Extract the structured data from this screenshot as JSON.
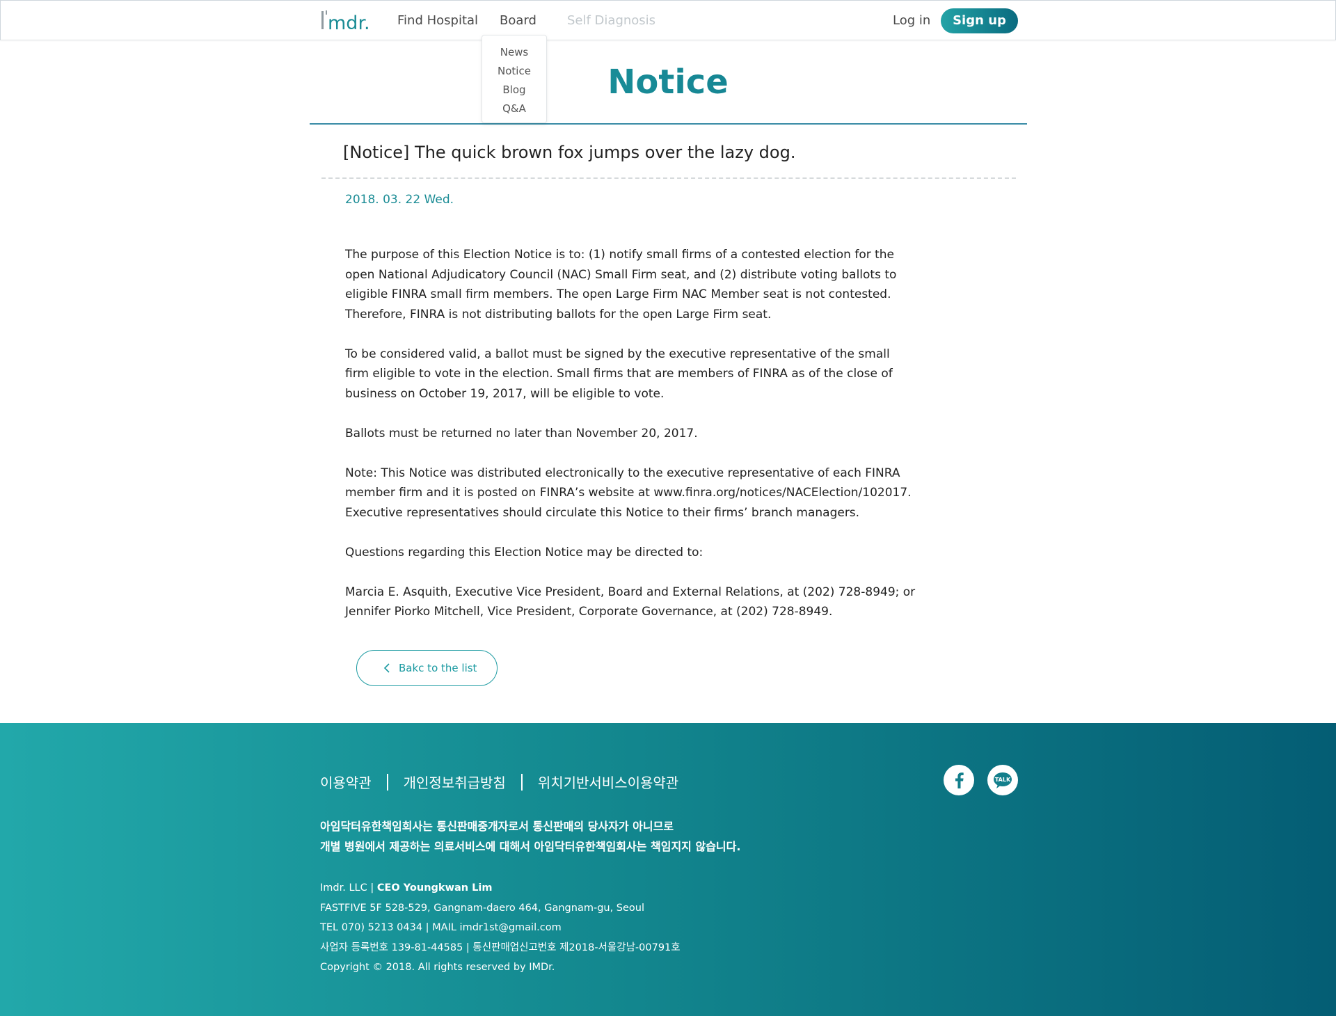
{
  "header": {
    "logo_text": "I'mdr.",
    "nav": {
      "find_hospital": "Find Hospital",
      "board": "Board",
      "self_diagnosis": "Self Diagnosis"
    },
    "login": "Log in",
    "signup": "Sign up",
    "board_menu": [
      "News",
      "Notice",
      "Blog",
      "Q&A"
    ]
  },
  "page_title": "Notice",
  "post": {
    "heading": "[Notice] The quick brown fox jumps over the lazy dog.",
    "date": "2018. 03. 22 Wed.",
    "paragraphs": [
      "The purpose of this Election Notice is to: (1) notify small firms of a contested election for the open National Adjudicatory Council (NAC) Small Firm seat, and (2) distribute voting ballots to eligible FINRA small firm members. The open Large Firm NAC Member seat is not contested. Therefore, FINRA is not distributing ballots for the open Large Firm seat.",
      "To be considered valid, a ballot must be signed by the executive representative of the small firm eligible to vote in the election. Small firms that are members of FINRA as of the close of business on October 19, 2017, will be eligible to vote.",
      "Ballots must be returned no later than November 20, 2017.",
      "Note: This Notice was distributed electronically to the executive representative of each FINRA member firm and it is posted on FINRA’s website at www.finra.org/notices/NACElection/102017. Executive representatives should circulate this Notice to their firms’ branch managers.",
      "Questions regarding this Election Notice may be directed to:",
      "Marcia E. Asquith, Executive Vice President, Board and External Relations, at (202) 728-8949; or Jennifer Piorko Mitchell, Vice President, Corporate Governance, at (202) 728-8949."
    ],
    "back_label": "Bakc to the list"
  },
  "footer": {
    "links": [
      "이용약관",
      "개인정보취급방침",
      "위치기반서비스이용약관"
    ],
    "notice_lines": [
      "아임닥터유한책임회사는 통신판매중개자로서 통신판매의 당사자가 아니므로",
      "개별 병원에서 제공하는 의료서비스에 대해서 아임닥터유한책임회사는 책임지지 않습니다."
    ],
    "company": "Imdr. LLC | ",
    "ceo": "CEO Youngkwan Lim",
    "address": "FASTFIVE 5F 528-529, Gangnam-daero 464, Gangnam-gu, Seoul",
    "contact": "TEL 070) 5213 0434 | MAIL  imdr1st@gmail.com",
    "registration": "사업자 등록번호 139-81-44585 | 통신판매업신고번호 제2018-서울강남-00791호",
    "copyright": "Copyright © 2018. All rights reserved by IMDr.",
    "social": [
      "facebook-icon",
      "kakao-talk-icon"
    ],
    "talk_label": "TALK"
  },
  "colors": {
    "accent": "#1b9aa1",
    "accent_dark": "#0a6b80",
    "text": "#222222",
    "muted_nav": "#c2c8cc"
  }
}
